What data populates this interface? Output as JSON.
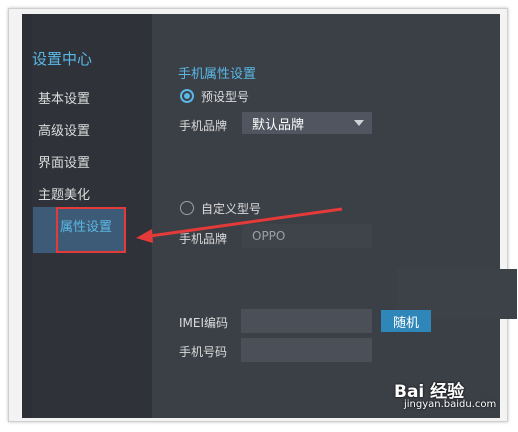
{
  "sidebar": {
    "title": "设置中心",
    "items": [
      {
        "label": "基本设置"
      },
      {
        "label": "高级设置"
      },
      {
        "label": "界面设置"
      },
      {
        "label": "主题美化"
      },
      {
        "label": "属性设置",
        "active": true
      }
    ]
  },
  "main": {
    "section_title": "手机属性设置",
    "preset": {
      "radio_label": "预设型号",
      "selected": true,
      "brand_label": "手机品牌",
      "brand_value": "默认品牌"
    },
    "custom": {
      "radio_label": "自定义型号",
      "selected": false,
      "brand_label": "手机品牌",
      "brand_value": "OPPO"
    },
    "imei": {
      "label": "IMEI编码",
      "value": "",
      "button_label": "随机"
    },
    "phone": {
      "label": "手机号码",
      "value": ""
    }
  },
  "watermark": {
    "main": "Bai 经验",
    "sub": "jingyan.baidu.com"
  },
  "colors": {
    "accent": "#5ab8e6",
    "annotation": "#e53a3a",
    "button": "#2f86b8"
  }
}
